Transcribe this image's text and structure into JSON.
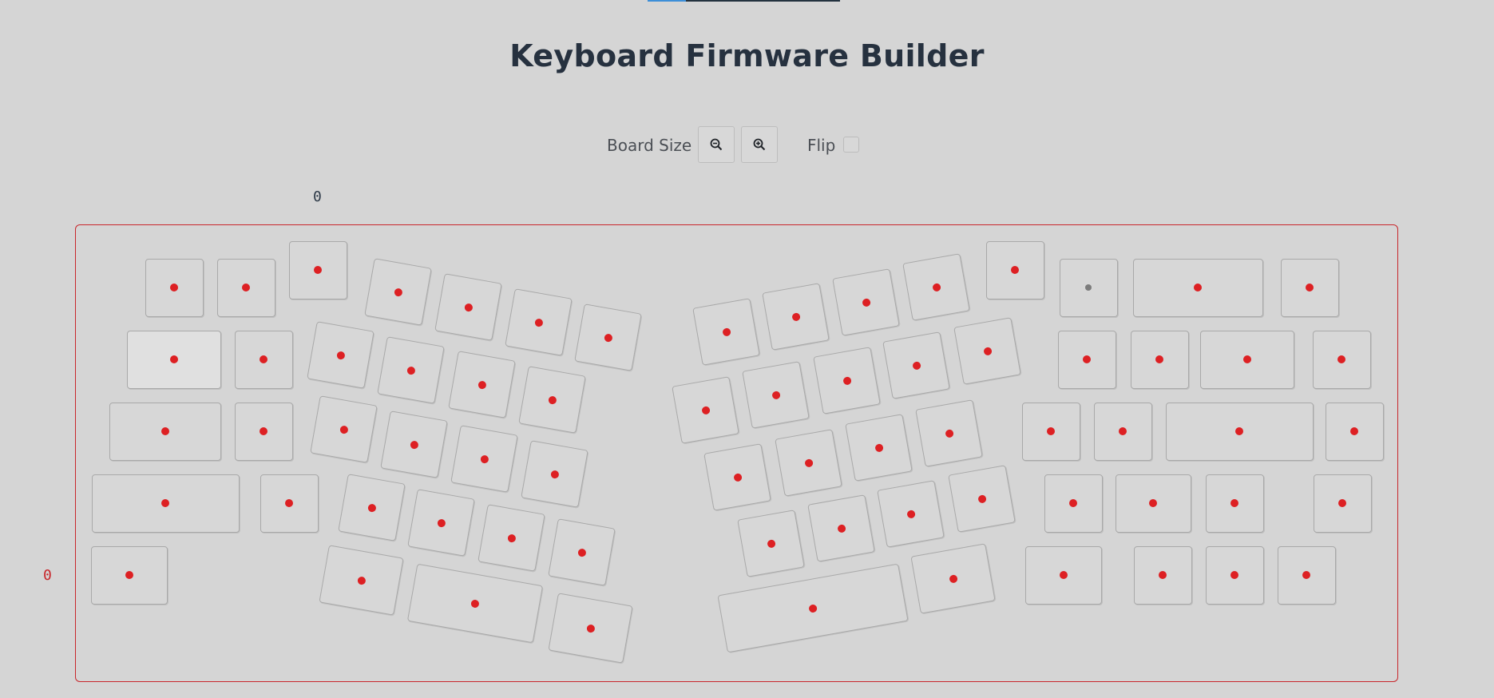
{
  "app": {
    "title": "Keyboard Firmware Builder",
    "load_progress": 0.2
  },
  "controls": {
    "board_size_label": "Board Size",
    "zoom_out_icon": "zoom-out-icon",
    "zoom_in_icon": "zoom-in-icon",
    "flip_label": "Flip",
    "flip_checked": false
  },
  "board": {
    "column_marker": "0",
    "row_marker": "0",
    "border_color": "#c8262b",
    "led_color": "#dd2023",
    "inactive_led_color": "#7c7c7c"
  }
}
